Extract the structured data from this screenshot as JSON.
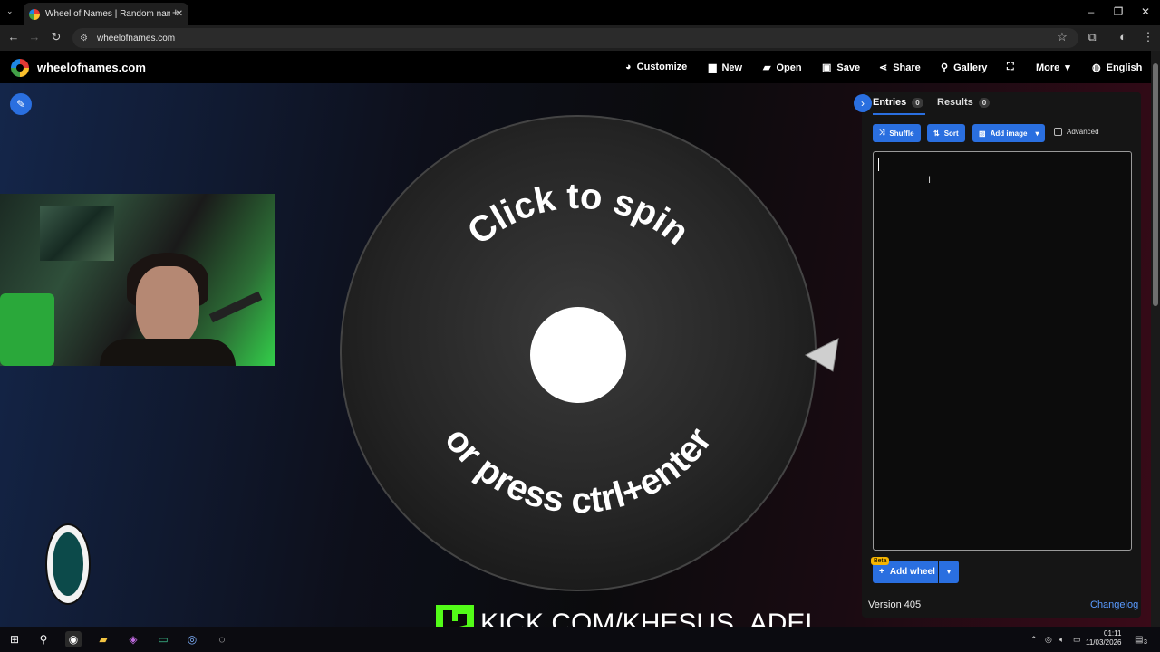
{
  "browser": {
    "tab_title": "Wheel of Names | Random nam",
    "url": "wheelofnames.com"
  },
  "header": {
    "brand": "wheelofnames.com",
    "menu": [
      {
        "label": "Customize",
        "icon": "palette-icon"
      },
      {
        "label": "New",
        "icon": "file-icon"
      },
      {
        "label": "Open",
        "icon": "folder-icon"
      },
      {
        "label": "Save",
        "icon": "save-icon"
      },
      {
        "label": "Share",
        "icon": "share-icon"
      },
      {
        "label": "Gallery",
        "icon": "search-icon"
      },
      {
        "label": "",
        "icon": "fullscreen-icon"
      },
      {
        "label": "More",
        "icon": "chevron-down-icon"
      },
      {
        "label": "English",
        "icon": "globe-icon"
      }
    ]
  },
  "wheel": {
    "top_text": "Click to spin",
    "bottom_text": "or press ctrl+enter"
  },
  "overlay": {
    "kick_text": "KICK.COM/KHESUS_ADEL"
  },
  "panel": {
    "tabs": [
      {
        "label": "Entries",
        "count": "0"
      },
      {
        "label": "Results",
        "count": "0"
      }
    ],
    "buttons": {
      "shuffle": "Shuffle",
      "sort": "Sort",
      "add_image": "Add image",
      "advanced": "Advanced"
    },
    "entries_value": "",
    "beta": "Beta",
    "add_wheel": "Add wheel",
    "version": "Version 405",
    "changelog": "Changelog"
  },
  "taskbar": {
    "time": "01:11",
    "date": "11/03/2026",
    "notifications": "3"
  },
  "colors": {
    "accent": "#2a6fe0",
    "kick_green": "#53fc18",
    "panel_bg": "#151515"
  }
}
